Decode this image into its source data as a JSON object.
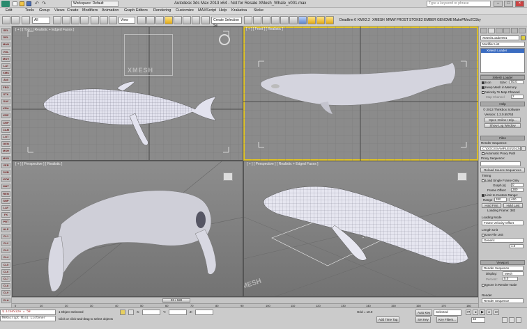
{
  "app": {
    "title": "Autodesk 3ds Max  2013 x64    - Not for Resale    XMesh_Whale_v001.max",
    "workspace": "Workspace: Default",
    "search_placeholder": "Type a keyword or phrase"
  },
  "menu": [
    "Edit",
    "Tools",
    "Group",
    "Views",
    "Create",
    "Modifiers",
    "Animation",
    "Graph Editors",
    "Rendering",
    "Customize",
    "MAXScript",
    "Help",
    "Krakatoa",
    "Stoke"
  ],
  "toolbar": {
    "filter": "All",
    "refcoord": "View",
    "selection_set": "Create Selection Se",
    "plugin_bar": [
      "Deadline 6",
      "KMX2.2",
      "XMESH",
      "MWW",
      "FROST",
      "STOKE2",
      "EMBER",
      "GENOME",
      "MakePMov2CSky"
    ]
  },
  "left_toolbar": [
    "SEL",
    "DEL",
    "MAN",
    "VOL",
    "MOV",
    "LAT",
    "XMS",
    "ANI",
    "FRO",
    "STK",
    "SAV",
    "KRA",
    "KRP",
    "CRP",
    "CAM",
    "LGT",
    "GEN",
    "MSH",
    "MOD",
    "VER",
    "SUB",
    "UVW",
    "MAT",
    "REN",
    "SNP",
    "LAY",
    "FX",
    "PRT",
    "HLP",
    "CL1",
    "CL2",
    "CL3",
    "CL4",
    "CL5",
    "CL6",
    "CL7",
    "CL8",
    "CL9",
    "CLA"
  ],
  "viewports": {
    "top": {
      "label": "[ + ] [ Top ] [ Realistic + Edged Faces ]",
      "logo_text": "XMESH"
    },
    "front": {
      "label": "[ + ] [ Front ] [ Realistic ]"
    },
    "persp1": {
      "label": "[ + ] [ Perspective ] [ Realistic ]"
    },
    "persp2": {
      "label": "[ + ] [ Perspective ] [ Realistic + Edged Faces ]",
      "ground_text": "XMESH"
    }
  },
  "command_panel": {
    "object_name": "XMeshLoader001",
    "modifier_list": "Modifier List",
    "stack_item": "XMesh Loader",
    "rollouts": {
      "xmesh_loader": "XMesh Loader",
      "icon_label": "Icon",
      "size_label": "Size:",
      "size_value": "50.0",
      "keep_mesh": "Keep Mesh in Memory",
      "velocity_map": "Velocity To Map Channel",
      "map_channel_label": "Map Channel",
      "map_channel_value": "2",
      "help": "Help",
      "copyright": "© 2013 Thinkbox Software",
      "version": "Version: 1.2.0.55763",
      "open_help": "Open Online Help...",
      "show_log": "Show Log Window",
      "files": "Files",
      "render_sequence_label": "Render Sequence:",
      "render_sequence_path": "C:\\DOCS\\SAMPLES\\2013\\assets",
      "auto_proxy": "Automatic Proxy Path",
      "proxy_sequence_label": "Proxy Sequence:",
      "reload_source": "Reload Source Sequences",
      "timing": "Timing",
      "load_single": "Load Single Frame Only",
      "graph_label": "Graph [s]",
      "graph_value": "0",
      "frame_offset_label": "Frame Offset:",
      "frame_offset_value": "380",
      "limit_range": "Limit to Custom Range:",
      "range_label": "Range",
      "range_start": "380",
      "range_end": "460",
      "hold_first": "Hold First",
      "hold_last": "Hold Last",
      "loading_frame": "Loading Frame: 382",
      "loading_mode": "Loading Mode",
      "loading_mode_value": "Frame Velocity Offset",
      "length_unit": "Length Unit",
      "use_file_unit": "Use File Unit",
      "unit_value": "Generic",
      "unit_scale": "1.0",
      "viewport": "Viewport",
      "viewport_seq": "Render Sequence",
      "display_label": "Display:",
      "display_value": "Mesh",
      "percent_label": "Percent:",
      "percent_value": "5.0",
      "ignore_render": "Ignore in Render Node",
      "render": "Render",
      "render_seq": "Render Sequence"
    }
  },
  "timeline": {
    "slider": "33 / 180",
    "ticks": [
      "0",
      "10",
      "20",
      "30",
      "40",
      "50",
      "60",
      "70",
      "80",
      "90",
      "100",
      "110",
      "120",
      "130",
      "140",
      "150",
      "160",
      "170",
      "180"
    ]
  },
  "status": {
    "maxscript_1": "$.iconSize = 50",
    "maxscript_2": "MAXScript Mini Listener",
    "selected": "1 Object Selected",
    "prompt": "Click or click-and-drag to select objects",
    "x_label": "X:",
    "y_label": "Y:",
    "z_label": "Z:",
    "grid": "Grid = 10.0",
    "auto_key": "Auto Key",
    "set_key": "Set Key",
    "selected_dd": "Selected",
    "key_filters": "Key Filters...",
    "add_time_tag": "Add Time Tag",
    "frame": "33"
  }
}
